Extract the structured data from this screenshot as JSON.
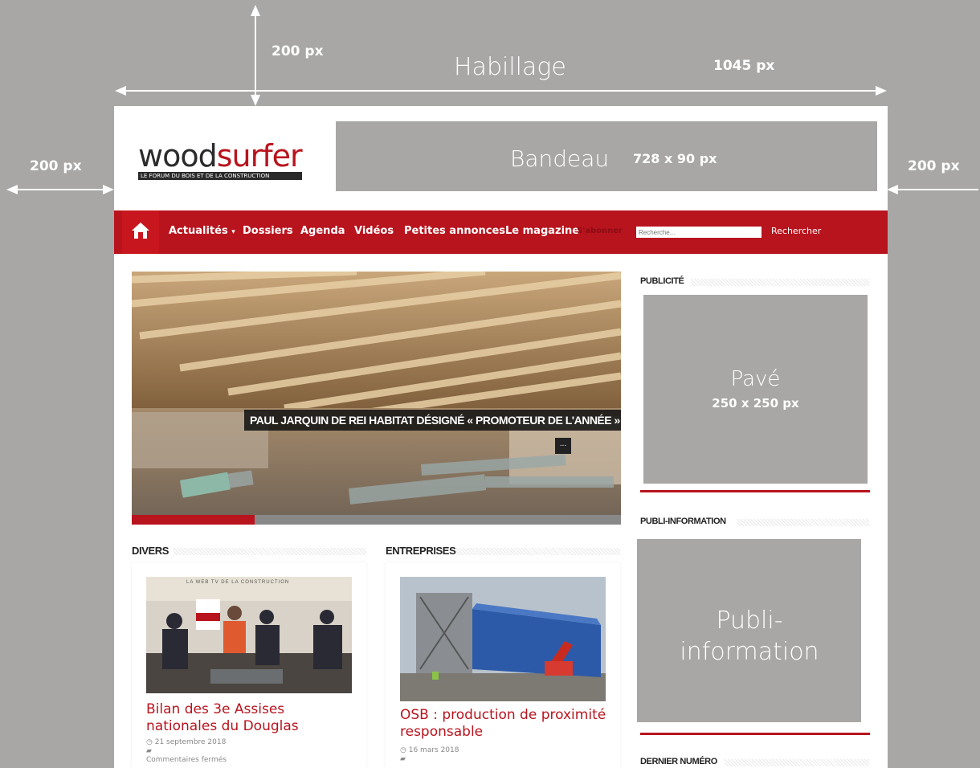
{
  "annotations": {
    "top_height": "200 px",
    "habillage": "Habillage",
    "width": "1045 px",
    "left_width": "200 px",
    "right_width": "200 px"
  },
  "header": {
    "logo_part1": "wood",
    "logo_part2": "surfer",
    "logo_tagline": "LE FORUM DU BOIS ET DE LA CONSTRUCTION",
    "banner_label": "Bandeau",
    "banner_size": "728 x 90 px"
  },
  "nav": {
    "items": [
      "Actualités",
      "Dossiers",
      "Agenda",
      "Vidéos",
      "Petites annonces",
      "Le magazine"
    ],
    "subscribe": "S'abonner",
    "search_placeholder": "Recherche...",
    "search_button": "Rechercher"
  },
  "hero": {
    "caption": "PAUL JARQUIN DE REI HABITAT DÉSIGNÉ « PROMOTEUR DE L'ANNÉE »",
    "more": "..."
  },
  "sections": {
    "divers": {
      "title": "Divers",
      "image_banner": "LA WEB TV DE LA CONSTRUCTION",
      "article_title": "Bilan des 3e Assises nationales du Douglas",
      "date": "21 septembre 2018",
      "comments": "Commentaires fermés"
    },
    "entreprises": {
      "title": "Entreprises",
      "article_title": "OSB : production de proximité responsable",
      "date": "16 mars 2018"
    }
  },
  "sidebar": {
    "pub_title": "PUBLICITÉ",
    "pave_label": "Pavé",
    "pave_size": "250 x 250 px",
    "publi_title": "PUBLI-INFORMATION",
    "publi_label": "Publi-information",
    "dernier_title": "DERNIER NUMÉRO"
  },
  "colors": {
    "brand_red": "#b8141e",
    "annotation_grey": "#a8a7a5"
  }
}
